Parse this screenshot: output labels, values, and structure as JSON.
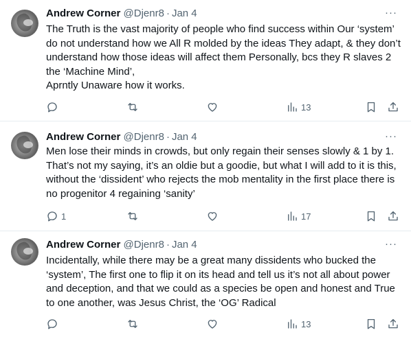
{
  "tweets": [
    {
      "name": "Andrew Corner",
      "handle": "@Djenr8",
      "sep": "·",
      "date": "Jan 4",
      "more": "···",
      "text": "The Truth is the vast majority of people who find success within Our ‘system’ do not understand how we All R molded by the ideas They adapt, & they don’t understand how those ideas will affect them Personally, bcs they R slaves 2 the ‘Machine Mind’,\nAprntly Unaware how it works.",
      "replies": "",
      "retweets": "",
      "likes": "",
      "views": "13"
    },
    {
      "name": "Andrew Corner",
      "handle": "@Djenr8",
      "sep": "·",
      "date": "Jan 4",
      "more": "···",
      "text": "Men lose their minds in crowds, but only regain their senses slowly & 1 by 1. That’s not my saying, it’s an oldie but a goodie, but what I will add to it is this, without the ‘dissident’  who rejects the mob mentality in the first place there is no progenitor 4 regaining ‘sanity’",
      "replies": "1",
      "retweets": "",
      "likes": "",
      "views": "17"
    },
    {
      "name": "Andrew Corner",
      "handle": "@Djenr8",
      "sep": "·",
      "date": "Jan 4",
      "more": "···",
      "text": "Incidentally, while there may be a great many dissidents who bucked the ‘system’, The first one to flip it on its head and tell us it’s not all about power and deception, and that we could as a species be open and honest and True to one another, was Jesus Christ, the ‘OG’ Radical",
      "replies": "",
      "retweets": "",
      "likes": "",
      "views": "13"
    }
  ],
  "icons": {
    "reply": "speech-bubble-icon",
    "retweet": "retweet-arrows-icon",
    "like": "heart-icon",
    "views": "bar-chart-icon",
    "bookmark": "bookmark-icon",
    "share": "share-upload-icon"
  },
  "colors": {
    "text": "#0f1419",
    "secondary": "#536471",
    "divider": "#e6ecf0",
    "background": "#ffffff"
  }
}
